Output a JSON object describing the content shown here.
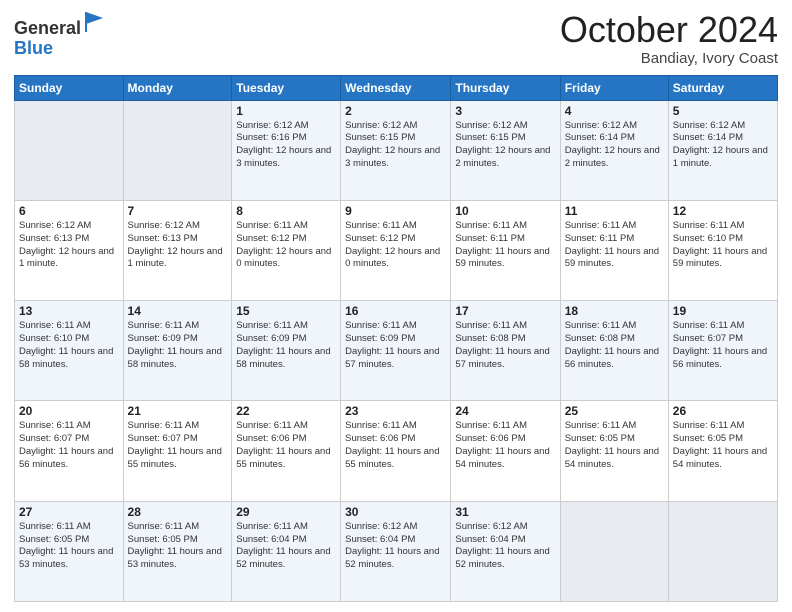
{
  "logo": {
    "general": "General",
    "blue": "Blue"
  },
  "header": {
    "month": "October 2024",
    "location": "Bandiay, Ivory Coast"
  },
  "days_of_week": [
    "Sunday",
    "Monday",
    "Tuesday",
    "Wednesday",
    "Thursday",
    "Friday",
    "Saturday"
  ],
  "weeks": [
    [
      {
        "day": "",
        "empty": true
      },
      {
        "day": "",
        "empty": true
      },
      {
        "day": "1",
        "sunrise": "Sunrise: 6:12 AM",
        "sunset": "Sunset: 6:16 PM",
        "daylight": "Daylight: 12 hours and 3 minutes."
      },
      {
        "day": "2",
        "sunrise": "Sunrise: 6:12 AM",
        "sunset": "Sunset: 6:15 PM",
        "daylight": "Daylight: 12 hours and 3 minutes."
      },
      {
        "day": "3",
        "sunrise": "Sunrise: 6:12 AM",
        "sunset": "Sunset: 6:15 PM",
        "daylight": "Daylight: 12 hours and 2 minutes."
      },
      {
        "day": "4",
        "sunrise": "Sunrise: 6:12 AM",
        "sunset": "Sunset: 6:14 PM",
        "daylight": "Daylight: 12 hours and 2 minutes."
      },
      {
        "day": "5",
        "sunrise": "Sunrise: 6:12 AM",
        "sunset": "Sunset: 6:14 PM",
        "daylight": "Daylight: 12 hours and 1 minute."
      }
    ],
    [
      {
        "day": "6",
        "sunrise": "Sunrise: 6:12 AM",
        "sunset": "Sunset: 6:13 PM",
        "daylight": "Daylight: 12 hours and 1 minute."
      },
      {
        "day": "7",
        "sunrise": "Sunrise: 6:12 AM",
        "sunset": "Sunset: 6:13 PM",
        "daylight": "Daylight: 12 hours and 1 minute."
      },
      {
        "day": "8",
        "sunrise": "Sunrise: 6:11 AM",
        "sunset": "Sunset: 6:12 PM",
        "daylight": "Daylight: 12 hours and 0 minutes."
      },
      {
        "day": "9",
        "sunrise": "Sunrise: 6:11 AM",
        "sunset": "Sunset: 6:12 PM",
        "daylight": "Daylight: 12 hours and 0 minutes."
      },
      {
        "day": "10",
        "sunrise": "Sunrise: 6:11 AM",
        "sunset": "Sunset: 6:11 PM",
        "daylight": "Daylight: 11 hours and 59 minutes."
      },
      {
        "day": "11",
        "sunrise": "Sunrise: 6:11 AM",
        "sunset": "Sunset: 6:11 PM",
        "daylight": "Daylight: 11 hours and 59 minutes."
      },
      {
        "day": "12",
        "sunrise": "Sunrise: 6:11 AM",
        "sunset": "Sunset: 6:10 PM",
        "daylight": "Daylight: 11 hours and 59 minutes."
      }
    ],
    [
      {
        "day": "13",
        "sunrise": "Sunrise: 6:11 AM",
        "sunset": "Sunset: 6:10 PM",
        "daylight": "Daylight: 11 hours and 58 minutes."
      },
      {
        "day": "14",
        "sunrise": "Sunrise: 6:11 AM",
        "sunset": "Sunset: 6:09 PM",
        "daylight": "Daylight: 11 hours and 58 minutes."
      },
      {
        "day": "15",
        "sunrise": "Sunrise: 6:11 AM",
        "sunset": "Sunset: 6:09 PM",
        "daylight": "Daylight: 11 hours and 58 minutes."
      },
      {
        "day": "16",
        "sunrise": "Sunrise: 6:11 AM",
        "sunset": "Sunset: 6:09 PM",
        "daylight": "Daylight: 11 hours and 57 minutes."
      },
      {
        "day": "17",
        "sunrise": "Sunrise: 6:11 AM",
        "sunset": "Sunset: 6:08 PM",
        "daylight": "Daylight: 11 hours and 57 minutes."
      },
      {
        "day": "18",
        "sunrise": "Sunrise: 6:11 AM",
        "sunset": "Sunset: 6:08 PM",
        "daylight": "Daylight: 11 hours and 56 minutes."
      },
      {
        "day": "19",
        "sunrise": "Sunrise: 6:11 AM",
        "sunset": "Sunset: 6:07 PM",
        "daylight": "Daylight: 11 hours and 56 minutes."
      }
    ],
    [
      {
        "day": "20",
        "sunrise": "Sunrise: 6:11 AM",
        "sunset": "Sunset: 6:07 PM",
        "daylight": "Daylight: 11 hours and 56 minutes."
      },
      {
        "day": "21",
        "sunrise": "Sunrise: 6:11 AM",
        "sunset": "Sunset: 6:07 PM",
        "daylight": "Daylight: 11 hours and 55 minutes."
      },
      {
        "day": "22",
        "sunrise": "Sunrise: 6:11 AM",
        "sunset": "Sunset: 6:06 PM",
        "daylight": "Daylight: 11 hours and 55 minutes."
      },
      {
        "day": "23",
        "sunrise": "Sunrise: 6:11 AM",
        "sunset": "Sunset: 6:06 PM",
        "daylight": "Daylight: 11 hours and 55 minutes."
      },
      {
        "day": "24",
        "sunrise": "Sunrise: 6:11 AM",
        "sunset": "Sunset: 6:06 PM",
        "daylight": "Daylight: 11 hours and 54 minutes."
      },
      {
        "day": "25",
        "sunrise": "Sunrise: 6:11 AM",
        "sunset": "Sunset: 6:05 PM",
        "daylight": "Daylight: 11 hours and 54 minutes."
      },
      {
        "day": "26",
        "sunrise": "Sunrise: 6:11 AM",
        "sunset": "Sunset: 6:05 PM",
        "daylight": "Daylight: 11 hours and 54 minutes."
      }
    ],
    [
      {
        "day": "27",
        "sunrise": "Sunrise: 6:11 AM",
        "sunset": "Sunset: 6:05 PM",
        "daylight": "Daylight: 11 hours and 53 minutes."
      },
      {
        "day": "28",
        "sunrise": "Sunrise: 6:11 AM",
        "sunset": "Sunset: 6:05 PM",
        "daylight": "Daylight: 11 hours and 53 minutes."
      },
      {
        "day": "29",
        "sunrise": "Sunrise: 6:11 AM",
        "sunset": "Sunset: 6:04 PM",
        "daylight": "Daylight: 11 hours and 52 minutes."
      },
      {
        "day": "30",
        "sunrise": "Sunrise: 6:12 AM",
        "sunset": "Sunset: 6:04 PM",
        "daylight": "Daylight: 11 hours and 52 minutes."
      },
      {
        "day": "31",
        "sunrise": "Sunrise: 6:12 AM",
        "sunset": "Sunset: 6:04 PM",
        "daylight": "Daylight: 11 hours and 52 minutes."
      },
      {
        "day": "",
        "empty": true
      },
      {
        "day": "",
        "empty": true
      }
    ]
  ]
}
